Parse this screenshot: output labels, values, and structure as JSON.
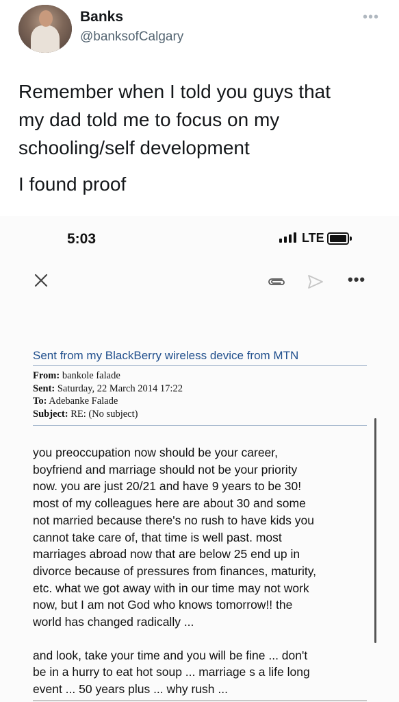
{
  "tweet": {
    "author_name": "Banks",
    "author_handle": "@banksofCalgary",
    "more_icon": "ellipsis-icon",
    "lines": [
      "Remember when I told you guys that",
      "my dad told me to focus on my",
      "schooling/self development",
      "I found proof"
    ]
  },
  "phone": {
    "status_time": "5:03",
    "network": "LTE",
    "icons": [
      "signal-icon",
      "battery-icon"
    ]
  },
  "mail_toolbar": {
    "icons": [
      "close-icon",
      "paperclip-icon",
      "send-icon",
      "more-icon"
    ]
  },
  "email": {
    "sent_from": "Sent from my BlackBerry wireless device from MTN",
    "from_label": "From:",
    "from_value": "bankole falade",
    "sent_label": "Sent:",
    "sent_value": "Saturday, 22 March 2014 17:22",
    "to_label": "To:",
    "to_value": "Adebanke Falade",
    "subject_label": "Subject:",
    "subject_value": "RE: (No subject)",
    "paragraph1": "you preoccupation now should be your career,\nboyfriend and marriage should not be your priority\nnow. you are just 20/21 and have 9 years to be 30!\nmost of my colleagues here are about 30 and some\nnot married because there's no rush to have kids you\ncannot take care of, that time is well past. most\nmarriages abroad now that are below 25 end up in\ndivorce because of pressures from finances, maturity,\netc. what we got away with in our time may not work\nnow, but I am not God who knows tomorrow!!  the\nworld has changed radically ...",
    "paragraph2": "and look, take your time and you will be fine ... don't\nbe in a hurry to eat hot soup ... marriage s a life long\nevent ... 50 years plus ... why rush ..."
  }
}
